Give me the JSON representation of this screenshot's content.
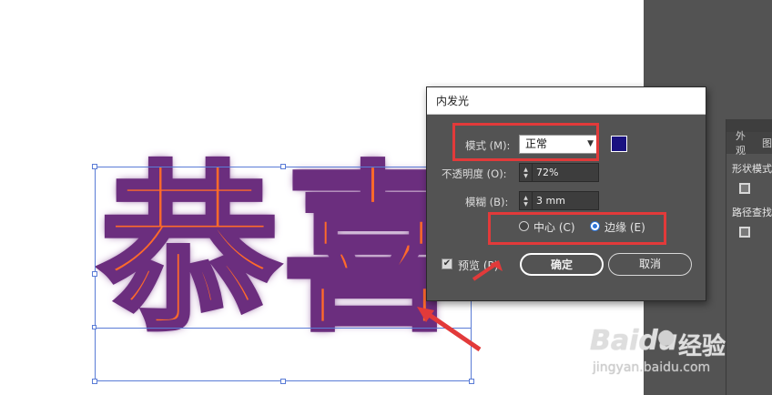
{
  "canvas": {
    "artwork_text": "恭喜",
    "glow_fill_color": "#ff6a2a",
    "glow_edge_color": "#6b2e7e"
  },
  "dialog": {
    "title": "内发光",
    "mode_label": "模式 (M):",
    "mode_value": "正常",
    "color_swatch": "#1a1280",
    "opacity_label": "不透明度 (O):",
    "opacity_value": "72%",
    "blur_label": "模糊 (B):",
    "blur_value": "3 mm",
    "center_label": "中心 (C)",
    "edge_label": "边缘 (E)",
    "selected_source": "边缘 (E)",
    "preview_label": "预览 (P)",
    "preview_checked": true,
    "ok_label": "确定",
    "cancel_label": "取消"
  },
  "side_panel": {
    "tab_1": "外观",
    "tab_2": "图",
    "shape_modes_label": "形状模式",
    "pathfinder_label": "路径查找"
  },
  "annotations": {
    "color": "#e23a3a"
  },
  "watermark": {
    "logo_text": "Baidu",
    "brand_text": "经验",
    "url_text": "jingyan.baidu.com"
  }
}
